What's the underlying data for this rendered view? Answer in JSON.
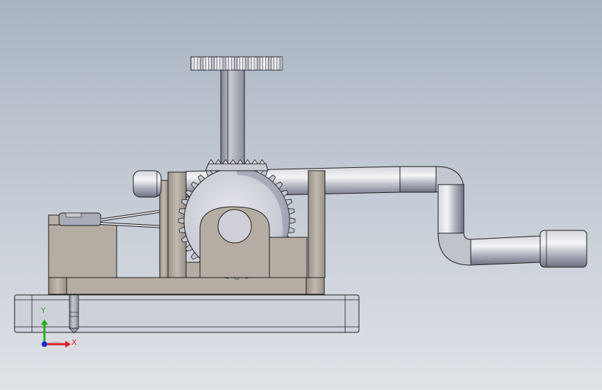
{
  "triad": {
    "x_label": "X",
    "y_label": "Y",
    "x_color": "#e02020",
    "y_color": "#20b020",
    "origin_color": "#1a2bd6"
  },
  "colors": {
    "background_top": "#a9b3c2",
    "background_bottom": "#dfe2e7",
    "part_tan": "#b2aaa0",
    "part_tan_dark": "#8d857b",
    "steel_light": "#e6e7ec",
    "steel_mid": "#a8aab6",
    "steel_dark": "#6a6c7a",
    "edge": "#1b1b1b"
  }
}
